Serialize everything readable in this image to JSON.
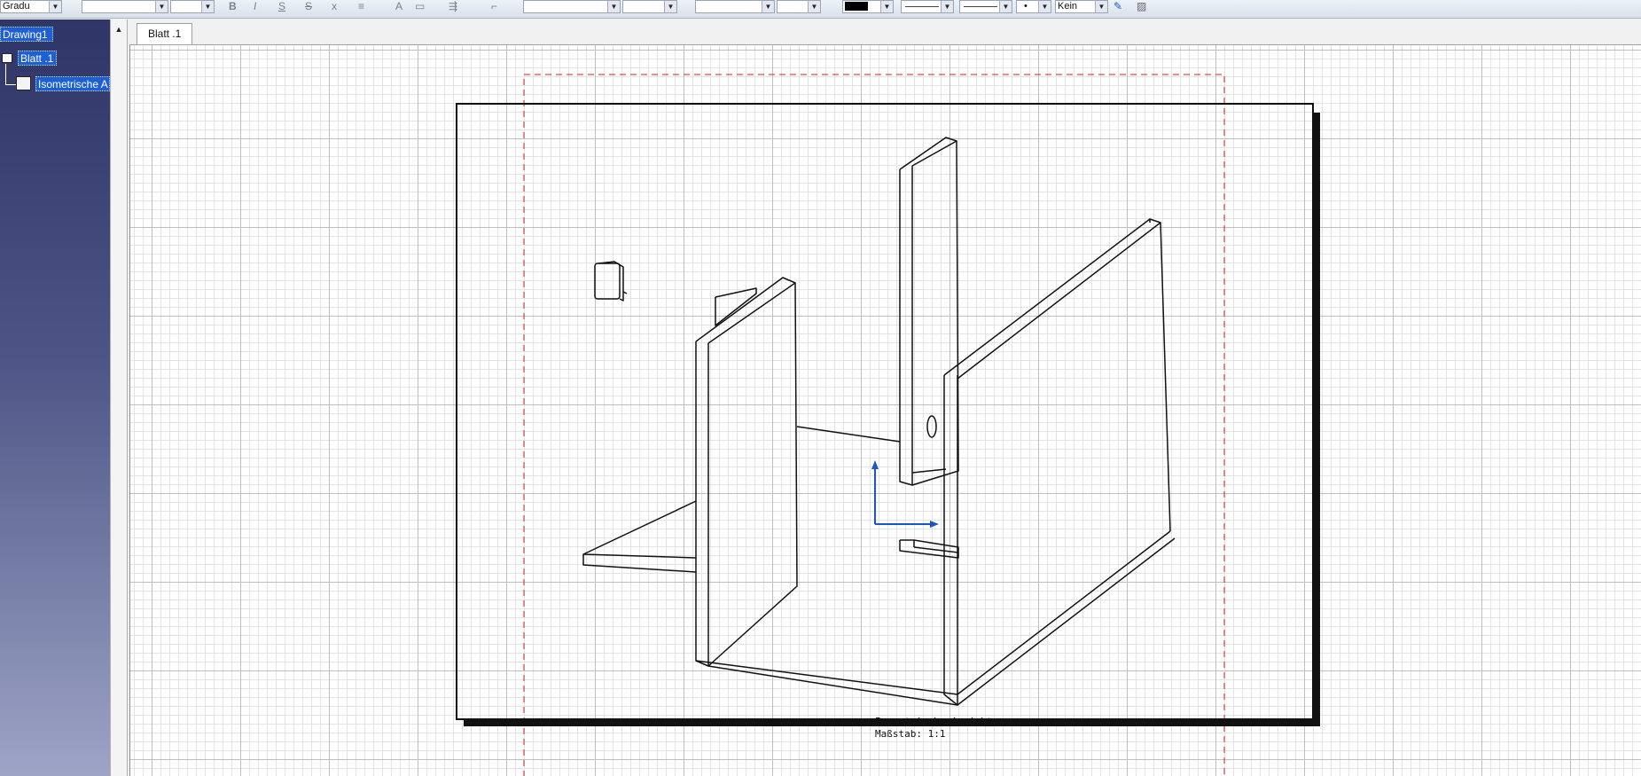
{
  "toolbar": {
    "style_value": "Gradu",
    "bold_icon": "bold-icon",
    "linetype_value": "Kein",
    "fill_color": "#000000"
  },
  "tree": {
    "root": "Drawing1",
    "sheet": "Blatt .1",
    "view": "Isometrische A"
  },
  "tabs": [
    {
      "label": "Blatt .1"
    }
  ],
  "view": {
    "caption_title": "Isometrische Ansicht",
    "caption_scale": "Maßstab:  1:1"
  },
  "colors": {
    "axis": "#1a56c8",
    "print_frame": "#d02020",
    "selection": "#1e5fd6"
  }
}
